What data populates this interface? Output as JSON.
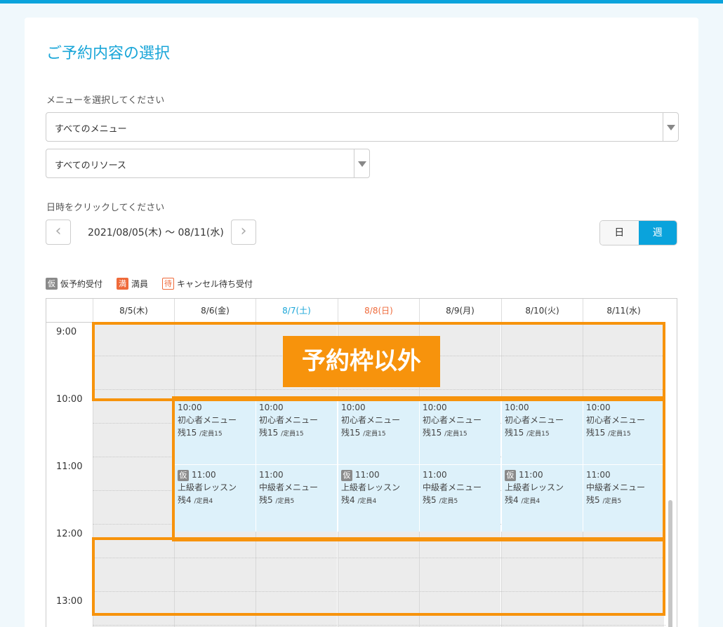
{
  "page": {
    "title": "ご予約内容の選択"
  },
  "menu": {
    "label": "メニューを選択してください",
    "selected": "すべてのメニュー"
  },
  "resource": {
    "selected": "すべてのリソース"
  },
  "datetime": {
    "label": "日時をクリックしてください",
    "range": "2021/08/05(木) 〜 08/11(水)",
    "prev": "‹",
    "next": "›"
  },
  "view": {
    "day": "日",
    "week": "週"
  },
  "legend": [
    {
      "badge": "仮",
      "text": "仮予約受付"
    },
    {
      "badge": "満",
      "text": "満員"
    },
    {
      "badge": "待",
      "text": "キャンセル待ち受付"
    }
  ],
  "days": [
    "8/5(木)",
    "8/6(金)",
    "8/7(土)",
    "8/8(日)",
    "8/9(月)",
    "8/10(火)",
    "8/11(水)"
  ],
  "day_colors": [
    "#333333",
    "#333333",
    "#1aa6d8",
    "#ef6a3a",
    "#333333",
    "#333333",
    "#333333"
  ],
  "hours": [
    "9:00",
    "10:00",
    "11:00",
    "12:00",
    "13:00"
  ],
  "slots10": [
    {
      "time": "10:00",
      "name": "初心者メニュー",
      "remain": "残15",
      "cap": "/定員15"
    },
    {
      "time": "10:00",
      "name": "初心者メニュー",
      "remain": "残15",
      "cap": "/定員15"
    },
    {
      "time": "10:00",
      "name": "初心者メニュー",
      "remain": "残15",
      "cap": "/定員15"
    },
    {
      "time": "10:00",
      "name": "初心者メニュー",
      "remain": "残15",
      "cap": "/定員15"
    },
    {
      "time": "10:00",
      "name": "初心者メニュー",
      "remain": "残15",
      "cap": "/定員15"
    },
    {
      "time": "10:00",
      "name": "初心者メニュー",
      "remain": "残15",
      "cap": "/定員15"
    }
  ],
  "slots11": [
    {
      "badge": "仮",
      "time": "11:00",
      "name": "上級者レッスン",
      "remain": "残4",
      "cap": "/定員4"
    },
    {
      "badge": "",
      "time": "11:00",
      "name": "中級者メニュー",
      "remain": "残5",
      "cap": "/定員5"
    },
    {
      "badge": "仮",
      "time": "11:00",
      "name": "上級者レッスン",
      "remain": "残4",
      "cap": "/定員4"
    },
    {
      "badge": "",
      "time": "11:00",
      "name": "中級者メニュー",
      "remain": "残5",
      "cap": "/定員5"
    },
    {
      "badge": "仮",
      "time": "11:00",
      "name": "上級者レッスン",
      "remain": "残4",
      "cap": "/定員4"
    },
    {
      "badge": "",
      "time": "11:00",
      "name": "中級者メニュー",
      "remain": "残5",
      "cap": "/定員5"
    }
  ],
  "annotation": {
    "text": "予約枠以外",
    "color": "#f7930c"
  }
}
